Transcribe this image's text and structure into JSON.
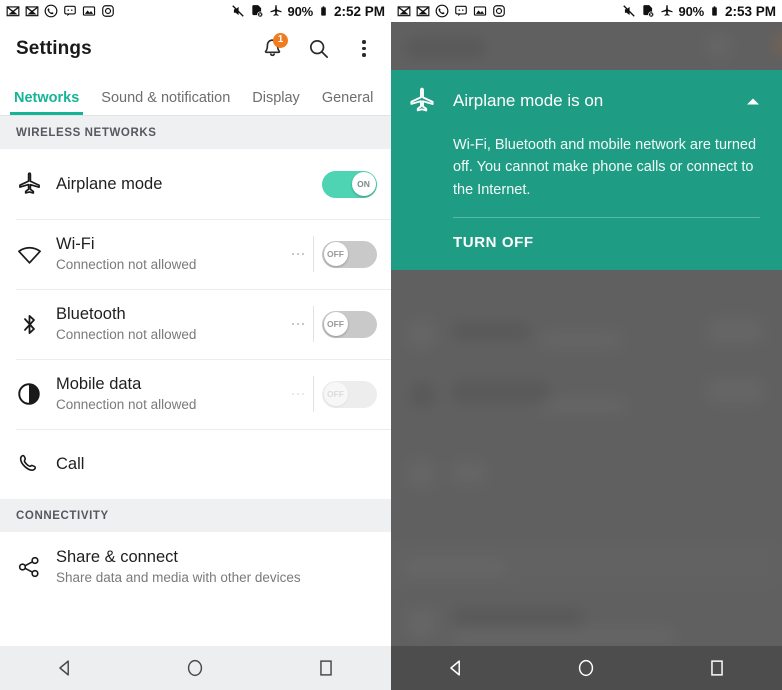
{
  "theme": {
    "accent_teal": "#16b496",
    "dialog_teal": "#1f9c84",
    "toggle_on_green": "#4ed3b3",
    "badge_orange": "#f07c1f",
    "section_bg": "#eef0f2",
    "dim_gray": "#6b6b6b"
  },
  "left": {
    "statusbar": {
      "left_icons": [
        "gmail-icon",
        "gmail-icon",
        "phone-circle-icon",
        "message-icon",
        "photo-icon",
        "camera-icon"
      ],
      "right_icons": [
        "mute-icon",
        "sync-off-icon",
        "airplane-icon"
      ],
      "battery_percent": "90%",
      "battery_icon": "battery-icon",
      "time": "2:52 PM"
    },
    "appbar": {
      "title": "Settings",
      "notification_badge": "1",
      "actions": [
        "notifications-bell-icon",
        "search-icon",
        "overflow-menu-icon"
      ]
    },
    "tabs": [
      {
        "label": "Networks",
        "active": true
      },
      {
        "label": "Sound & notification",
        "active": false
      },
      {
        "label": "Display",
        "active": false
      },
      {
        "label": "General",
        "active": false
      }
    ],
    "sections": [
      {
        "header": "WIRELESS NETWORKS",
        "rows": [
          {
            "icon": "airplane-icon",
            "title": "Airplane mode",
            "subtitle": "",
            "has_ellipsis": false,
            "toggle": "ON",
            "toggle_state": "on",
            "dim": false
          },
          {
            "icon": "wifi-icon",
            "title": "Wi-Fi",
            "subtitle": "Connection not allowed",
            "has_ellipsis": true,
            "toggle": "OFF",
            "toggle_state": "off",
            "dim": false
          },
          {
            "icon": "bluetooth-icon",
            "title": "Bluetooth",
            "subtitle": "Connection not allowed",
            "has_ellipsis": true,
            "toggle": "OFF",
            "toggle_state": "off",
            "dim": false
          },
          {
            "icon": "mobile-data-icon",
            "title": "Mobile data",
            "subtitle": "Connection not allowed",
            "has_ellipsis": true,
            "toggle": "OFF",
            "toggle_state": "off",
            "dim": true
          },
          {
            "icon": "call-icon",
            "title": "Call",
            "subtitle": "",
            "has_ellipsis": false,
            "toggle": "",
            "toggle_state": "none",
            "dim": false
          }
        ]
      },
      {
        "header": "CONNECTIVITY",
        "rows": [
          {
            "icon": "share-icon",
            "title": "Share & connect",
            "subtitle": "Share data and media with other devices",
            "has_ellipsis": false,
            "toggle": "",
            "toggle_state": "none",
            "dim": false
          }
        ]
      }
    ],
    "navbar": [
      "back-icon",
      "home-icon",
      "recents-icon"
    ]
  },
  "right": {
    "statusbar": {
      "left_icons": [
        "gmail-icon",
        "gmail-icon",
        "phone-circle-icon",
        "message-icon",
        "photo-icon",
        "camera-icon"
      ],
      "right_icons": [
        "mute-icon",
        "sync-off-icon",
        "airplane-icon"
      ],
      "battery_percent": "90%",
      "battery_icon": "battery-icon",
      "time": "2:53 PM"
    },
    "dialog": {
      "icon": "airplane-icon",
      "title": "Airplane mode is on",
      "collapse_icon": "chevron-up-icon",
      "body": "Wi-Fi, Bluetooth and mobile network are turned off. You cannot make phone calls or connect to the Internet.",
      "action_label": "TURN OFF"
    },
    "navbar": [
      "back-icon",
      "home-icon",
      "recents-icon"
    ]
  }
}
